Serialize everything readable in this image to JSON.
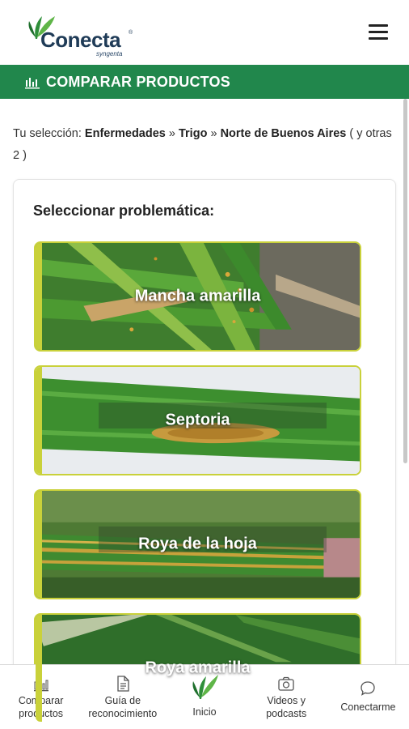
{
  "brand": {
    "name": "Conecta",
    "registered": "®",
    "sub": "syngenta"
  },
  "section": {
    "title": "COMPARAR PRODUCTOS",
    "icon": "bar-chart-icon"
  },
  "selection": {
    "prefix": "Tu selección: ",
    "crumbs": [
      "Enfermedades",
      "Trigo",
      "Norte de Buenos Aires"
    ],
    "separator": " » ",
    "suffix": " ( y otras 2 )"
  },
  "card": {
    "title": "Seleccionar problemática:",
    "tiles": [
      {
        "label": "Mancha amarilla"
      },
      {
        "label": "Septoria"
      },
      {
        "label": "Roya de la hoja"
      },
      {
        "label": "Roya amarilla"
      }
    ]
  },
  "bottom_nav": [
    {
      "label": "Comparar productos",
      "icon": "bar-chart-icon"
    },
    {
      "label": "Guía de reconocimiento",
      "icon": "document-icon"
    },
    {
      "label": "Inicio",
      "icon": "leaf-logo-icon"
    },
    {
      "label": "Videos y podcasts",
      "icon": "camera-icon"
    },
    {
      "label": "Conectarme",
      "icon": "chat-bubble-icon"
    }
  ],
  "colors": {
    "brand_green": "#21874c",
    "tile_accent": "#c9d13a",
    "navy": "#1f3b57"
  }
}
